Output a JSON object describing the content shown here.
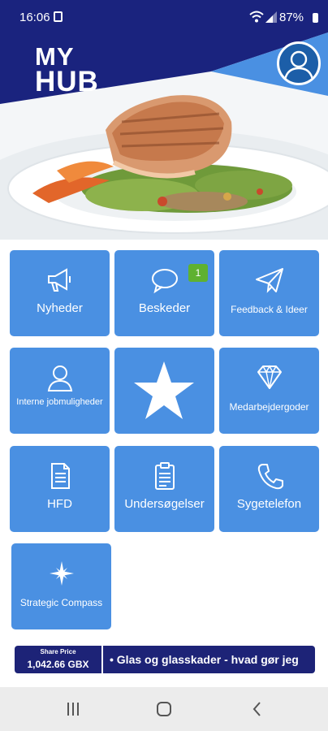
{
  "status_bar": {
    "time": "16:06",
    "battery": "87%"
  },
  "header": {
    "logo_line1": "MY",
    "logo_line2": "HUB"
  },
  "tiles": [
    {
      "label": "Nyheder",
      "icon": "megaphone-icon"
    },
    {
      "label": "Beskeder",
      "icon": "chat-bubble-icon",
      "badge": "1"
    },
    {
      "label": "Feedback & Ideer",
      "icon": "paper-plane-icon"
    },
    {
      "label": "Interne jobmuligheder",
      "icon": "person-icon"
    },
    {
      "label": "",
      "icon": "star-icon"
    },
    {
      "label": "Medarbejdergoder",
      "icon": "diamond-icon"
    },
    {
      "label": "HFD",
      "icon": "document-icon"
    },
    {
      "label": "Undersøgelser",
      "icon": "clipboard-icon"
    },
    {
      "label": "Sygetelefon",
      "icon": "phone-icon"
    },
    {
      "label": "Strategic Compass",
      "icon": "compass-star-icon"
    }
  ],
  "ticker": {
    "share_label": "Share Price",
    "share_value": "1,042.66 GBX",
    "headline": "•  Glas og glasskader - hvad gør jeg"
  },
  "colors": {
    "navy": "#1a237e",
    "tile_blue": "#4a90e2",
    "badge_green": "#5fb130",
    "ticker_bg": "#1d2377"
  }
}
